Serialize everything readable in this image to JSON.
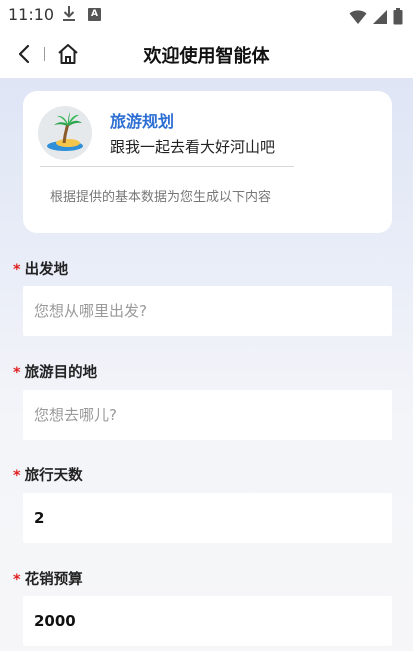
{
  "status_bar": {
    "time": "11:10",
    "a_badge": "A",
    "icons": [
      "download-icon",
      "a-badge-icon",
      "wifi-icon",
      "signal-icon",
      "battery-icon"
    ]
  },
  "nav": {
    "title": "欢迎使用智能体",
    "icons": [
      "back-arrow-icon",
      "home-icon"
    ]
  },
  "intro": {
    "avatar_icon": "palm-island-icon",
    "title": "旅游规划",
    "subtitle": "跟我一起去看大好河山吧",
    "note": "根据提供的基本数据为您生成以下内容"
  },
  "form": {
    "required_mark": "*",
    "fields": [
      {
        "label": "出发地",
        "placeholder": "您想从哪里出发?",
        "value": ""
      },
      {
        "label": "旅游目的地",
        "placeholder": "您想去哪儿?",
        "value": ""
      },
      {
        "label": "旅行天数",
        "placeholder": "",
        "value": "2"
      },
      {
        "label": "花销预算",
        "placeholder": "",
        "value": "2000"
      }
    ]
  },
  "colors": {
    "accent_blue": "#2e6fd3",
    "required_red": "#e02020",
    "background_top": "#dfe5f5",
    "background_bottom": "#f6f6f8"
  }
}
